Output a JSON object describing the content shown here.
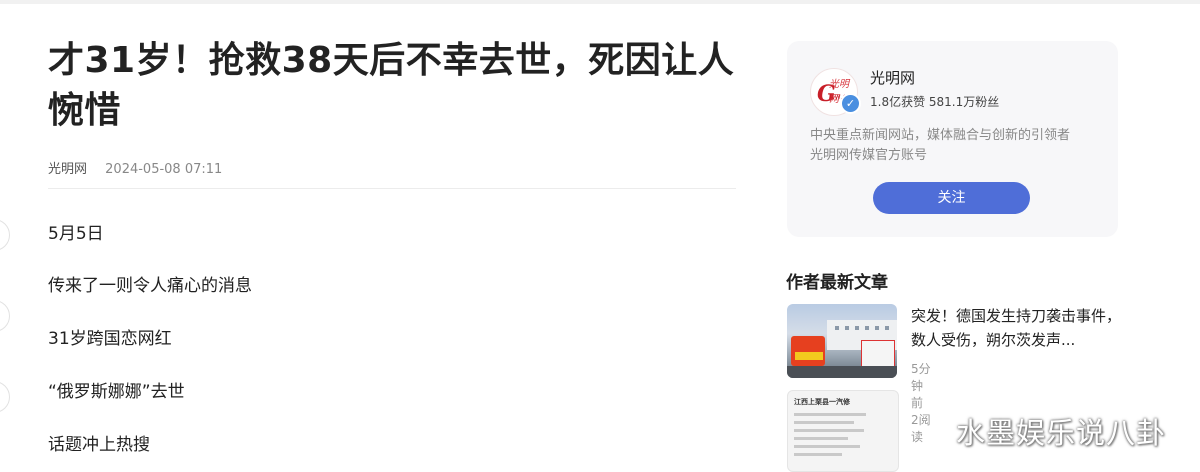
{
  "article": {
    "title": "才31岁！抢救38天后不幸去世，死因让人惋惜",
    "source": "光明网",
    "date": "2024-05-08 07:11",
    "paragraphs": [
      "5月5日",
      "传来了一则令人痛心的消息",
      "31岁跨国恋网红",
      "“俄罗斯娜娜”去世",
      "话题冲上热搜"
    ]
  },
  "author_card": {
    "name": "光明网",
    "stats": "1.8亿获赞 581.1万粉丝",
    "desc_lines": [
      "中央重点新闻网站，媒体融合与创新的引领者",
      "光明网传媒官方账号"
    ],
    "follow_label": "关注",
    "logo_letter": "G",
    "logo_script": "光明网",
    "logo_sub": "MW.CN",
    "verified_icon": "✓"
  },
  "latest": {
    "section_title": "作者最新文章",
    "items": [
      {
        "title": "突发！德国发生持刀袭击事件，数人受伤，朔尔茨发声...",
        "time": "5分钟前",
        "reads": "2阅读"
      },
      {
        "thumb_heading": "江西上栗县一汽修"
      }
    ]
  },
  "watermark": "水墨娱乐说八卦",
  "colors": {
    "accent": "#4f6ed8",
    "brand": "#c81e28"
  }
}
